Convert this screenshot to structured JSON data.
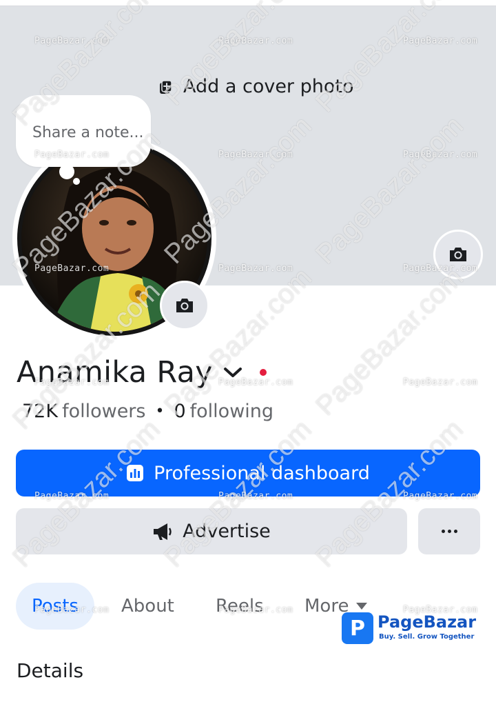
{
  "cover": {
    "add_label": "Add a cover photo"
  },
  "note": {
    "placeholder": "Share a note..."
  },
  "profile": {
    "name": "Anamika Ray",
    "followers_count": "72K",
    "followers_label": "followers",
    "following_count": "0",
    "following_label": "following"
  },
  "actions": {
    "dashboard_label": "Professional dashboard",
    "advertise_label": "Advertise",
    "more_icon": "ellipsis-icon"
  },
  "tabs": [
    {
      "label": "Posts"
    },
    {
      "label": "About"
    },
    {
      "label": "Reels"
    },
    {
      "label": "More"
    }
  ],
  "section": {
    "details_title": "Details"
  },
  "watermark": {
    "text": "PageBazar.com",
    "small_text": "PageBazar.com",
    "brand_name": "PageBazar",
    "brand_tagline": "Buy. Sell. Grow Together"
  },
  "colors": {
    "primary": "#0866ff",
    "button_gray": "#e4e6eb",
    "cover_gray": "#dfe2e6",
    "notification_red": "#e41e3f"
  }
}
